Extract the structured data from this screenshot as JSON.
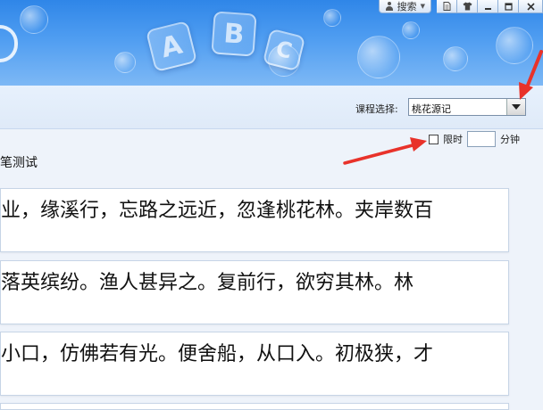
{
  "toolbar": {
    "search_label": "搜索",
    "window_buttons": [
      "file-icon",
      "shirt-icon",
      "minimize-icon",
      "maximize-icon",
      "close-icon"
    ]
  },
  "banner": {
    "letters": [
      "A",
      "B",
      "C"
    ]
  },
  "course": {
    "label": "课程选择:",
    "selected": "桃花源记"
  },
  "timelimit": {
    "label": "限时",
    "minutes_value": "",
    "unit": "分钟"
  },
  "mode_title": "笔测试",
  "passages": [
    "业，缘溪行，忘路之远近，忽逢桃花林。夹岸数百",
    "落英缤纷。渔人甚异之。复前行，欲穷其林。林",
    "小口，仿佛若有光。便舍船，从口入。初极狭，才"
  ],
  "annotation_color": "#e8322a"
}
